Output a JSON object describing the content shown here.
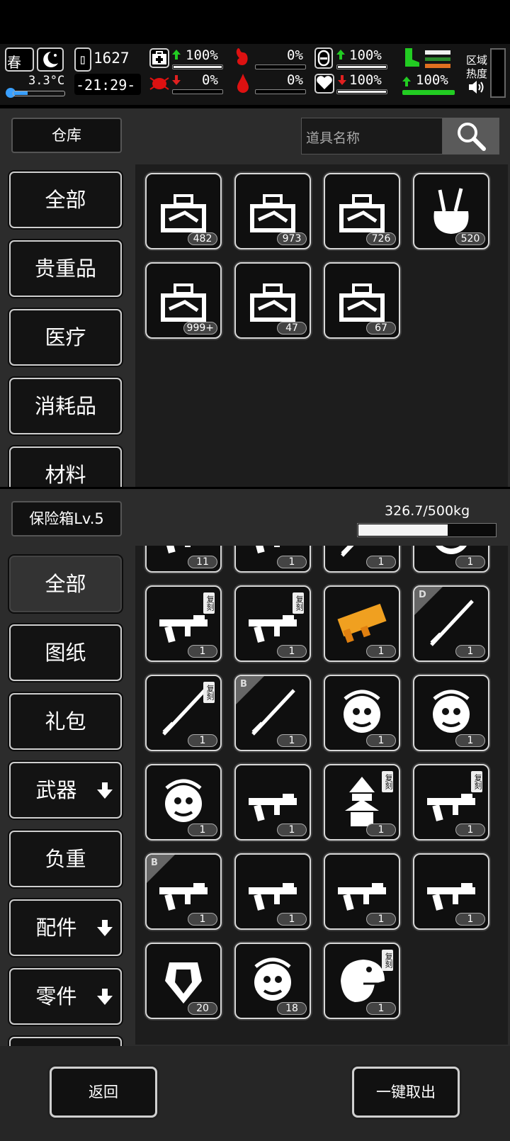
{
  "hud": {
    "season": "春",
    "temperature": "3.3°C",
    "day": "1627",
    "time": "-21:29-",
    "health_pct": "100%",
    "hunger_pct": "0%",
    "protection_pct": "100%",
    "infection_pct": "0%",
    "bleeding_pct": "0%",
    "heart_pct": "100%",
    "stamina_pct": "100%",
    "region_label": "区域",
    "heat_label": "热度"
  },
  "warehouse": {
    "title": "仓库",
    "search_placeholder": "道具名称",
    "categories": [
      "全部",
      "贵重品",
      "医疗",
      "消耗品",
      "材料"
    ],
    "items": [
      {
        "icon": "toolbox-icon",
        "count": "482"
      },
      {
        "icon": "tool-case-icon",
        "count": "973"
      },
      {
        "icon": "tool-chest-icon",
        "count": "726"
      },
      {
        "icon": "tool-bag-icon",
        "count": "520"
      },
      {
        "icon": "tool-box-open-icon",
        "count": "999+"
      },
      {
        "icon": "car-toolbox-icon",
        "count": "47"
      },
      {
        "icon": "car-toolbox-icon",
        "count": "67"
      }
    ]
  },
  "safe": {
    "title": "保险箱Lv.5",
    "weight": "326.7/500kg",
    "weight_fraction": 0.653,
    "categories": [
      "全部",
      "图纸",
      "礼包",
      "武器",
      "负重",
      "配件",
      "零件"
    ],
    "items_partial": [
      {
        "icon": "pistol-icon",
        "count": "11"
      },
      {
        "icon": "rifle-icon",
        "count": "1"
      },
      {
        "icon": "blade-icon",
        "count": "1"
      },
      {
        "icon": "mech-icon",
        "count": "1"
      }
    ],
    "items": [
      {
        "icon": "magazine-belt-icon",
        "count": "1",
        "tag": "复刻"
      },
      {
        "icon": "sniper-rifle-icon",
        "count": "1",
        "tag": "复刻"
      },
      {
        "icon": "golden-shotgun-icon",
        "count": "1"
      },
      {
        "icon": "katana-icon",
        "count": "1",
        "grade": "D"
      },
      {
        "icon": "whip-icon",
        "count": "1",
        "tag": "复刻"
      },
      {
        "icon": "scorpion-whip-icon",
        "count": "1",
        "grade": "B"
      },
      {
        "icon": "medusa-icon",
        "count": "1"
      },
      {
        "icon": "medusa-icon",
        "count": "1"
      },
      {
        "icon": "medusa-icon",
        "count": "1"
      },
      {
        "icon": "ornate-gun-icon",
        "count": "1"
      },
      {
        "icon": "pagoda-icon",
        "count": "1",
        "tag": "复刻"
      },
      {
        "icon": "ornate-rifle-icon",
        "count": "1",
        "tag": "复刻"
      },
      {
        "icon": "assault-rifle-icon",
        "count": "1",
        "grade": "B"
      },
      {
        "icon": "long-rifle-icon",
        "count": "1"
      },
      {
        "icon": "smg-icon",
        "count": "1"
      },
      {
        "icon": "blaster-icon",
        "count": "1"
      },
      {
        "icon": "armor-icon",
        "count": "20"
      },
      {
        "icon": "creature-icon",
        "count": "18"
      },
      {
        "icon": "dinosaur-icon",
        "count": "1",
        "tag": "复刻"
      }
    ]
  },
  "footer": {
    "back_label": "返回",
    "take_all_label": "一键取出"
  }
}
